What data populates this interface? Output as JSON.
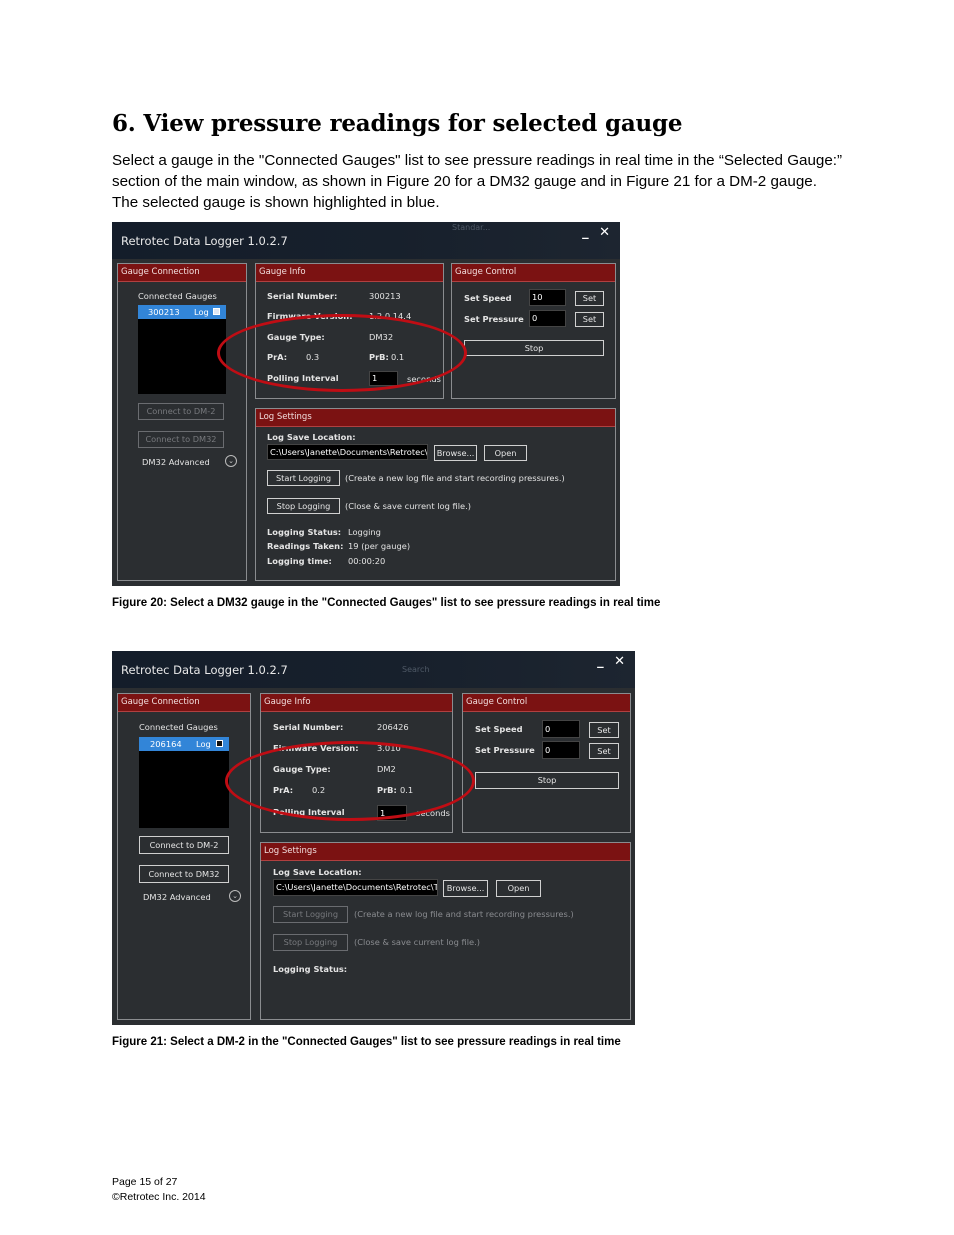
{
  "heading": "6. View pressure readings for selected gauge",
  "intro": "Select a gauge in the \"Connected Gauges\" list to see pressure readings in real time in the “Selected Gauge:” section of the main window, as shown in Figure 20 for a DM32 gauge and in Figure 21 for a DM-2 gauge.  The selected gauge is shown highlighted in blue.",
  "fig1": {
    "title": "Retrotec Data Logger 1.0.2.7",
    "ghost": "Standar...",
    "controls": "_ ✕",
    "conn": {
      "header": "Gauge Connection",
      "list_label": "Connected Gauges",
      "selected_gauge": "300213",
      "log_label": "Log",
      "connect_dm2": "Connect to DM-2",
      "connect_dm32": "Connect to DM32",
      "advanced": "DM32 Advanced"
    },
    "info": {
      "header": "Gauge Info",
      "serial_label": "Serial Number:",
      "serial_value": "300213",
      "firmware_label": "Firmware Version:",
      "firmware_value": "1.2.0.14.4",
      "type_label": "Gauge Type:",
      "type_value": "DM32",
      "pra_label": "PrA:",
      "pra_value": "0.3",
      "prb_label": "PrB:",
      "prb_value": "0.1",
      "polling_label": "Polling Interval",
      "polling_value": "1",
      "seconds": "seconds"
    },
    "control": {
      "header": "Gauge Control",
      "speed_label": "Set Speed",
      "speed_value": "10",
      "pressure_label": "Set Pressure",
      "pressure_value": "0",
      "set": "Set",
      "stop": "Stop"
    },
    "log": {
      "header": "Log Settings",
      "location_label": "Log Save Location:",
      "path": "C:\\Users\\Janette\\Documents\\Retrotec\\Te",
      "browse": "Browse...",
      "open": "Open",
      "start": "Start Logging",
      "start_desc": "(Create a new log file and start recording pressures.)",
      "stop": "Stop Logging",
      "stop_desc": "(Close & save current log file.)",
      "status_label": "Logging Status:",
      "status_value": "Logging",
      "readings_label": "Readings Taken:",
      "readings_value": "19 (per gauge)",
      "time_label": "Logging time:",
      "time_value": "00:00:20"
    }
  },
  "caption1": "Figure 20:  Select a DM32 gauge in the \"Connected Gauges\" list to see pressure readings in real time",
  "fig2": {
    "title": "Retrotec Data Logger 1.0.2.7",
    "ghost": "Search",
    "controls": "_ ✕",
    "conn": {
      "header": "Gauge Connection",
      "list_label": "Connected Gauges",
      "selected_gauge": "206164",
      "log_label": "Log",
      "connect_dm2": "Connect to DM-2",
      "connect_dm32": "Connect to DM32",
      "advanced": "DM32 Advanced"
    },
    "info": {
      "header": "Gauge Info",
      "serial_label": "Serial Number:",
      "serial_value": "206426",
      "firmware_label": "Firmware Version:",
      "firmware_value": "3.010",
      "type_label": "Gauge Type:",
      "type_value": "DM2",
      "pra_label": "PrA:",
      "pra_value": "0.2",
      "prb_label": "PrB:",
      "prb_value": "0.1",
      "polling_label": "Polling Interval",
      "polling_value": "1",
      "seconds": "seconds"
    },
    "control": {
      "header": "Gauge Control",
      "speed_label": "Set Speed",
      "speed_value": "0",
      "pressure_label": "Set Pressure",
      "pressure_value": "0",
      "set": "Set",
      "stop": "Stop"
    },
    "log": {
      "header": "Log Settings",
      "location_label": "Log Save Location:",
      "path": "C:\\Users\\Janette\\Documents\\Retrotec\\Te",
      "browse": "Browse...",
      "open": "Open",
      "start": "Start Logging",
      "start_desc": "(Create a new log file and start recording pressures.)",
      "stop": "Stop Logging",
      "stop_desc": "(Close & save current log file.)",
      "status_label": "Logging Status:"
    }
  },
  "caption2": "Figure 21: Select a DM-2 in the \"Connected Gauges\" list to see pressure readings in real time",
  "footer": {
    "page": "Page 15 of 27",
    "copyright": "©Retrotec Inc. 2014"
  },
  "colors": {
    "panel_header": "#7b1212",
    "selection": "#3285d8",
    "highlight_oval": "#c00d14",
    "window_bg": "#2b2e31"
  }
}
